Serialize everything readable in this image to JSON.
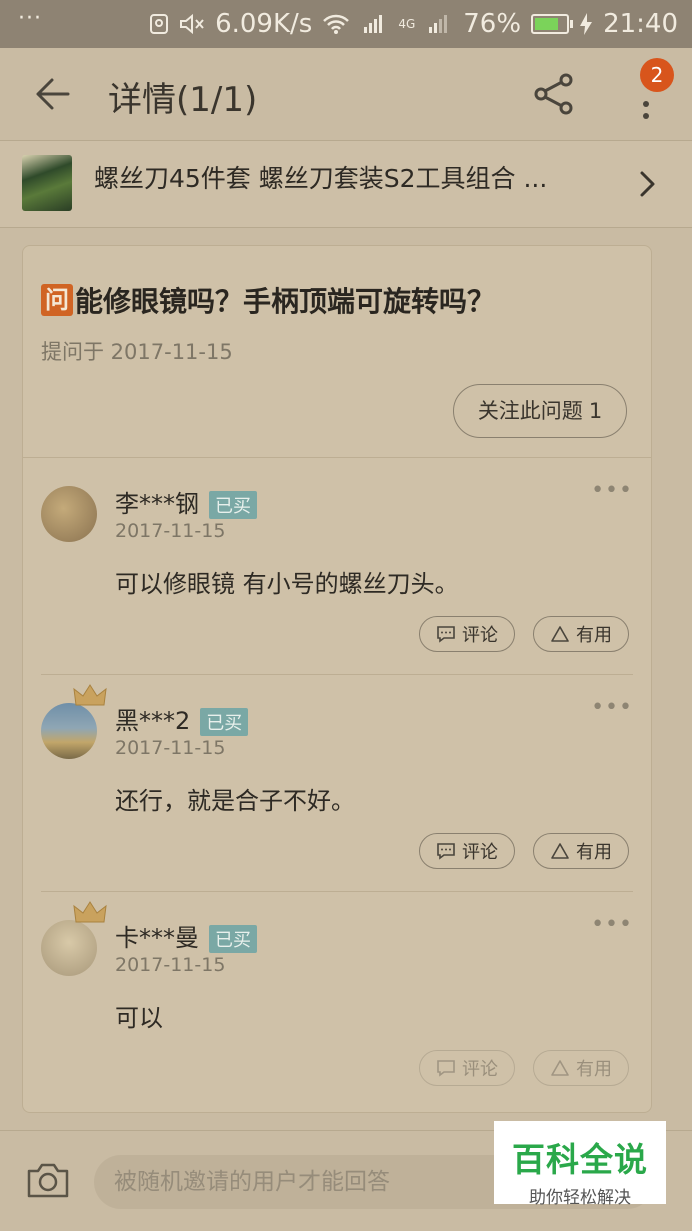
{
  "status_bar": {
    "menu_dots": "···",
    "speed": "6.09K/s",
    "signal_tag": "4G",
    "battery": "76%",
    "battery_level": 0.76,
    "time": "21:40"
  },
  "header": {
    "title": "详情(1/1)",
    "notification_count": "2"
  },
  "product": {
    "name": "螺丝刀45件套 螺丝刀套装S2工具组合 ..."
  },
  "question": {
    "tag": "问",
    "text": "能修眼镜吗？手柄顶端可旋转吗？",
    "asked_date": "提问于 2017-11-15",
    "follow_label": "关注此问题",
    "follow_count": "1"
  },
  "answers": [
    {
      "user": "李***钢",
      "badge": "已买",
      "date": "2017-11-15",
      "text": "可以修眼镜 有小号的螺丝刀头。",
      "comment_label": "评论",
      "useful_label": "有用",
      "has_crown": false,
      "avatar_color": "#a08a62"
    },
    {
      "user": "黑***2",
      "badge": "已买",
      "date": "2017-11-15",
      "text": "还行，就是合子不好。",
      "comment_label": "评论",
      "useful_label": "有用",
      "has_crown": true,
      "avatar_color": "#6f8fa8"
    },
    {
      "user": "卡***曼",
      "badge": "已买",
      "date": "2017-11-15",
      "text": "可以",
      "comment_label": "评论",
      "useful_label": "有用",
      "has_crown": true,
      "avatar_color": "#b3a88c"
    }
  ],
  "bottom_bar": {
    "input_placeholder": "被随机邀请的用户才能回答"
  },
  "watermark": {
    "main": "百科全说",
    "sub": "助你轻松解决"
  },
  "colors": {
    "overlay_background": "#c9bba3",
    "accent": "#d8551c",
    "bought_badge": "#7aa8a5"
  }
}
